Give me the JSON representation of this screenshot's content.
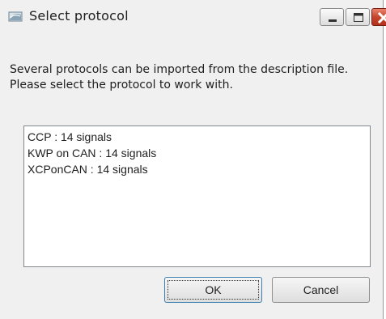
{
  "window": {
    "title": "Select protocol",
    "icon": "protocol-app-icon",
    "controls": {
      "minimize_icon": "minimize-icon",
      "maximize_icon": "maximize-icon",
      "close_icon": "close-icon"
    }
  },
  "message": "Several protocols can be imported from the description file. Please select the protocol to work with.",
  "protocols": [
    {
      "label": "CCP : 14 signals"
    },
    {
      "label": "KWP on CAN : 14 signals"
    },
    {
      "label": "XCPonCAN : 14 signals"
    }
  ],
  "buttons": {
    "ok_label": "OK",
    "cancel_label": "Cancel"
  },
  "colors": {
    "close_button": "#c5452d",
    "window_background": "#f0f0f0",
    "default_button_border": "#3c7fb1"
  }
}
